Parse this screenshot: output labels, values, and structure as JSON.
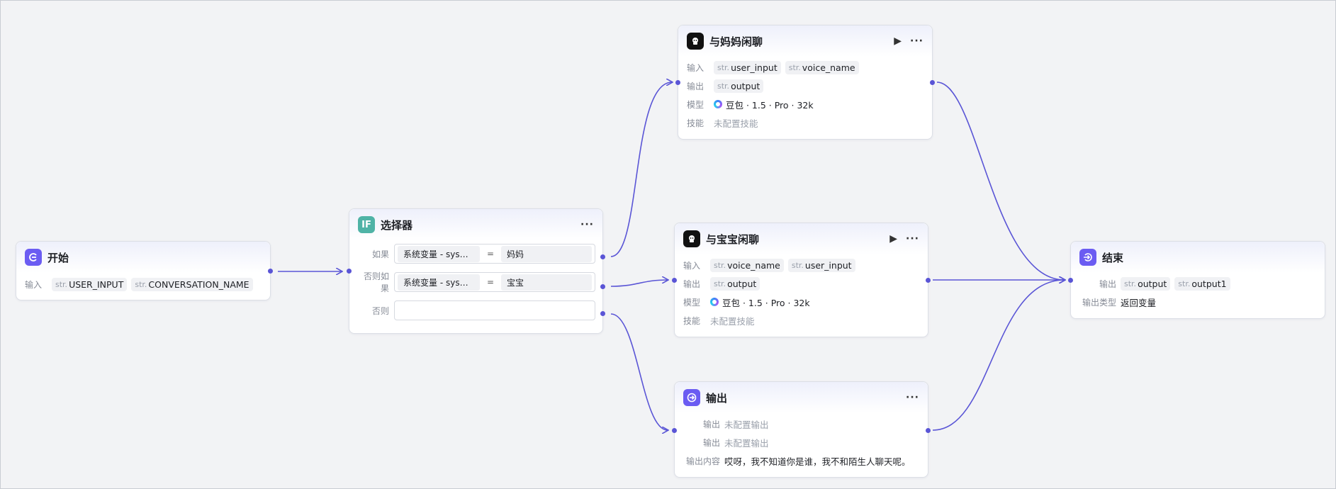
{
  "canvas": {
    "edge_color": "#5a55d6",
    "background": "#f2f3f5"
  },
  "start_node": {
    "title": "开始",
    "icon": "start-icon",
    "input_label": "输入",
    "inputs": [
      {
        "type": "str.",
        "name": "USER_INPUT"
      },
      {
        "type": "str.",
        "name": "CONVERSATION_NAME"
      }
    ]
  },
  "selector_node": {
    "title": "选择器",
    "icon_text": "IF",
    "more": "···",
    "conditions": [
      {
        "label": "如果",
        "left": "系统变量 - sys…",
        "op": "=",
        "right": "妈妈"
      },
      {
        "label": "否则如果",
        "left": "系统变量 - sys…",
        "op": "=",
        "right": "宝宝"
      },
      {
        "label": "否则",
        "left": "",
        "op": "",
        "right": ""
      }
    ]
  },
  "mom_chat_node": {
    "title": "与妈妈闲聊",
    "more": "···",
    "run": "▶",
    "input_label": "输入",
    "inputs": [
      {
        "type": "str.",
        "name": "user_input"
      },
      {
        "type": "str.",
        "name": "voice_name"
      }
    ],
    "output_label": "输出",
    "outputs": [
      {
        "type": "str.",
        "name": "output"
      }
    ],
    "model_label": "模型",
    "model": "豆包 · 1.5 · Pro · 32k",
    "skill_label": "技能",
    "skill_value": "未配置技能"
  },
  "baby_chat_node": {
    "title": "与宝宝闲聊",
    "more": "···",
    "run": "▶",
    "input_label": "输入",
    "inputs": [
      {
        "type": "str.",
        "name": "voice_name"
      },
      {
        "type": "str.",
        "name": "user_input"
      }
    ],
    "output_label": "输出",
    "outputs": [
      {
        "type": "str.",
        "name": "output"
      }
    ],
    "model_label": "模型",
    "model": "豆包 · 1.5 · Pro · 32k",
    "skill_label": "技能",
    "skill_value": "未配置技能"
  },
  "output_node": {
    "title": "输出",
    "more": "···",
    "rows": [
      {
        "label": "输出",
        "value": "未配置输出"
      },
      {
        "label": "输出",
        "value": "未配置输出"
      }
    ],
    "content_label": "输出内容",
    "content_value": "哎呀，我不知道你是谁，我不和陌生人聊天呢。"
  },
  "end_node": {
    "title": "结束",
    "output_label": "输出",
    "outputs": [
      {
        "type": "str.",
        "name": "output"
      },
      {
        "type": "str.",
        "name": "output1"
      }
    ],
    "output_type_label": "输出类型",
    "output_type_value": "返回变量"
  }
}
